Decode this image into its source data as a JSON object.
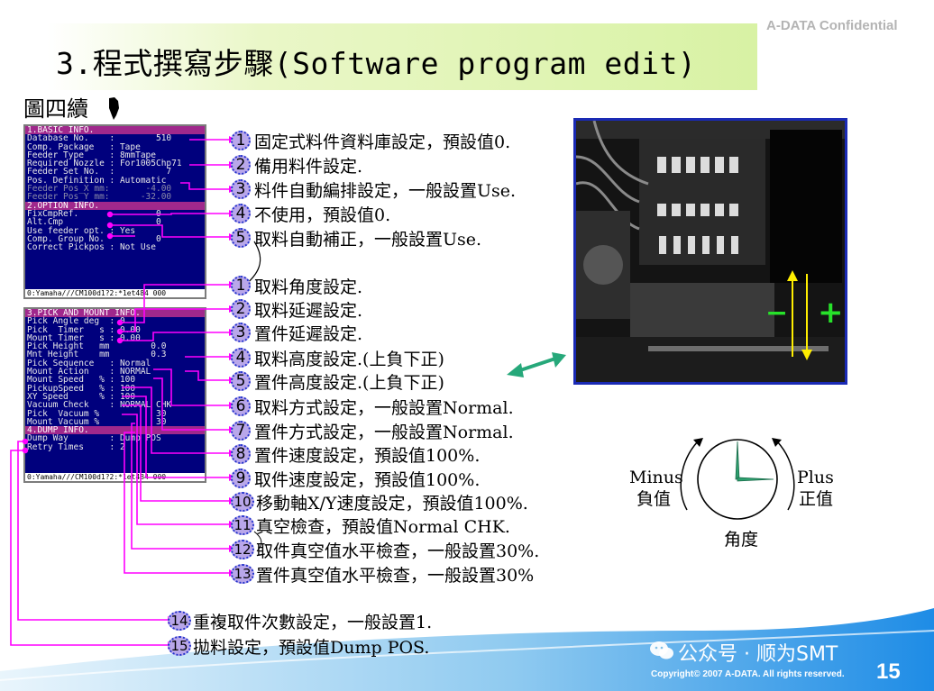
{
  "header": {
    "title": "3.程式撰寫步驟(Software program edit)",
    "confidential": "A-DATA Confidential",
    "subhead": "圖四續"
  },
  "screen1": {
    "section1": "1.BASIC INFO.",
    "rows1": [
      "Database No.    :        510",
      "Comp. Package   : Tape",
      "Feeder Type     : 8mmTape",
      "Required Nozzle : For1005Chp71",
      "Feeder Set No.  :          7",
      "Pos. Definition : Automatic"
    ],
    "rows1_dim": [
      "Feeder Pos_X mm:       -4.00",
      "Feeder Pos_Y mm:      -32.00"
    ],
    "section2": "2.OPTION INFO.",
    "rows2": [
      "FixCmpRef.               0",
      "Alt.Cmp                  0",
      "Use feeder opt. : Yes",
      "Comp. Group No.          0",
      "Correct Pickpos : Not Use"
    ],
    "footer": "0:Yamaha///CM100d1?2:*1et484 000"
  },
  "screen2": {
    "section3": "3.PICK AND MOUNT INFO.",
    "rows3": [
      "Pick Angle deg  : 0",
      "Pick  Timer   s : 0.00",
      "Mount Timer   s : 0.00",
      "Pick Height   mm        0.0",
      "Mnt Height    mm        0.3",
      "Pick Sequence   : Normal",
      "Mount Action    : NORMAL",
      "Mount Speed   % : 100",
      "PickupSpeed   % : 100",
      "XY Speed      % : 100",
      "Vacuum Check    : NORMAL CHK",
      "Pick  Vacuum %           30",
      "Mount Vacuum %           30"
    ],
    "section4": "4.DUMP INFO.",
    "rows4": [
      "Dump Way        : Dump POS",
      "Retry Times     : 2"
    ],
    "footer": "0:Yamaha///CM100d1?2:*1et484 000"
  },
  "items_top": [
    {
      "num": "1",
      "text": "固定式料件資料庫設定，預設值0."
    },
    {
      "num": "2",
      "text": "備用料件設定."
    },
    {
      "num": "3",
      "text": "料件自動編排設定，一般設置Use."
    },
    {
      "num": "4",
      "text": "不使用，預設值0."
    },
    {
      "num": "5",
      "text": "取料自動補正，一般設置Use."
    }
  ],
  "items_bottom": [
    {
      "num": "1",
      "text": "取料角度設定."
    },
    {
      "num": "2",
      "text": "取料延遲設定."
    },
    {
      "num": "3",
      "text": "置件延遲設定."
    },
    {
      "num": "4",
      "text": "取料高度設定.(上負下正)"
    },
    {
      "num": "5",
      "text": "置件高度設定.(上負下正)"
    },
    {
      "num": "6",
      "text": "取料方式設定，一般設置Normal."
    },
    {
      "num": "7",
      "text": "置件方式設定，一般設置Normal."
    },
    {
      "num": "8",
      "text": "置件速度設定，預設值100%."
    },
    {
      "num": "9",
      "text": "取件速度設定，預設值100%."
    },
    {
      "num": "10",
      "text": "移動軸X/Y速度設定，預設值100%."
    },
    {
      "num": "11",
      "text": "真空檢查，預設值Normal CHK."
    },
    {
      "num": "12",
      "text": "取件真空值水平檢查，一般設置30%."
    },
    {
      "num": "13",
      "text": "置件真空值水平檢查，一般設置30%"
    },
    {
      "num": "14",
      "text": "重複取件次數設定，一般設置1."
    },
    {
      "num": "15",
      "text": "拋料設定，預設值Dump POS."
    }
  ],
  "dial": {
    "minus_en": "Minus",
    "minus_zh": "負值",
    "plus_en": "Plus",
    "plus_zh": "正值",
    "angle": "角度"
  },
  "photo": {
    "minus_sign": "−",
    "plus_sign": "+"
  },
  "footer": {
    "watermark": "公众号 · 顺为SMT",
    "copyright": "Copyright© 2007 A-DATA. All rights reserved.",
    "page": "15"
  },
  "colors": {
    "accent_magenta": "#ff00ff",
    "badge_fill": "#b9a7ea",
    "screen_bg": "#00007d",
    "footer_blue": "#1e8ce6"
  }
}
